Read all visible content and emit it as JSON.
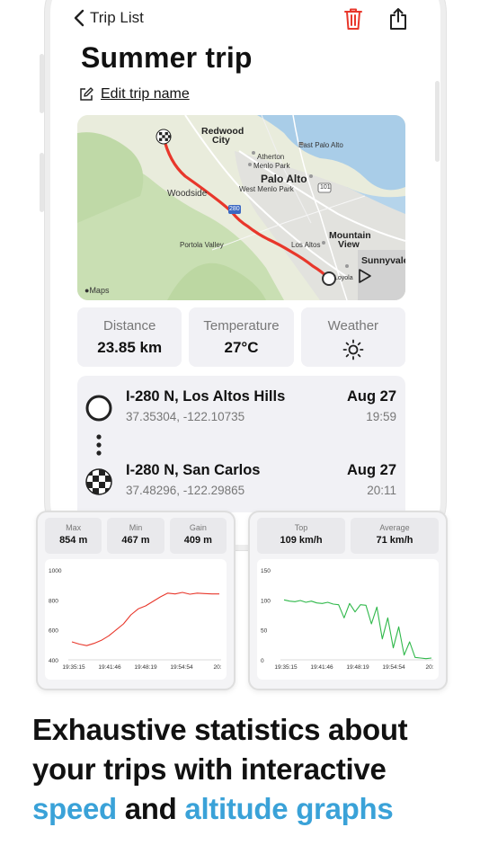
{
  "nav": {
    "back_label": "Trip List"
  },
  "trip": {
    "title": "Summer trip",
    "edit_label": "Edit trip name"
  },
  "map": {
    "labels": {
      "redwood": "Redwood",
      "city": "City",
      "east_palo_alto": "East Palo Alto",
      "atherton": "Atherton",
      "menlo_park": "Menlo Park",
      "palo_alto": "Palo Alto",
      "west_menlo_park": "West Menlo Park",
      "woodside": "Woodside",
      "portola_valley": "Portola Valley",
      "los_altos": "Los Altos",
      "mountain": "Mountain",
      "view": "View",
      "sunnyvale": "Sunnyvale",
      "loyola": "Loyola",
      "hwy_101": "101",
      "hwy_280": "280",
      "maps_logo": "Maps"
    },
    "route_color": "#e8372b"
  },
  "stats": [
    {
      "label": "Distance",
      "value": "23.85 km"
    },
    {
      "label": "Temperature",
      "value": "27°C"
    },
    {
      "label": "Weather",
      "icon": "sun-icon"
    }
  ],
  "stops": [
    {
      "name": "I-280 N, Los Altos Hills",
      "coords": "37.35304, -122.10735",
      "date": "Aug 27",
      "time": "19:59"
    },
    {
      "name": "I-280 N, San Carlos",
      "coords": "37.48296, -122.29865",
      "date": "Aug 27",
      "time": "20:11"
    }
  ],
  "altitude": {
    "stats": [
      {
        "label": "Max",
        "value": "854 m"
      },
      {
        "label": "Min",
        "value": "467 m"
      },
      {
        "label": "Gain",
        "value": "409 m"
      }
    ]
  },
  "speed": {
    "stats": [
      {
        "label": "Top",
        "value": "109 km/h"
      },
      {
        "label": "Average",
        "value": "71 km/h"
      }
    ]
  },
  "headline": {
    "line1": "Exhaustive statistics about",
    "line2": "your trips with interactive",
    "word_speed": "speed",
    "word_and": " and ",
    "word_altitude": "altitude graphs"
  },
  "colors": {
    "accent": "#3aa2d8",
    "trash": "#e8372b",
    "altitude_line": "#e8372b",
    "speed_line": "#2fb84a"
  },
  "chart_data": [
    {
      "type": "line",
      "series": [
        {
          "values": [
            520,
            505,
            495,
            510,
            530,
            560,
            600,
            640,
            700,
            740,
            760,
            790,
            820,
            845,
            840,
            850,
            838,
            845,
            842,
            840,
            840
          ]
        }
      ],
      "x_ticks": [
        "19:35:15",
        "19:41:46",
        "19:48:19",
        "19:54:54",
        "20:"
      ],
      "y_ticks": [
        "400",
        "600",
        "800",
        "1000"
      ],
      "ylim": [
        400,
        1000
      ],
      "color": "#e8372b"
    },
    {
      "type": "line",
      "series": [
        {
          "values": [
            100,
            98,
            97,
            99,
            96,
            98,
            95,
            94,
            96,
            93,
            92,
            70,
            94,
            80,
            92,
            91,
            60,
            88,
            35,
            70,
            20,
            55,
            8,
            30,
            4,
            3,
            2,
            3
          ]
        }
      ],
      "x_ticks": [
        "19:35:15",
        "19:41:46",
        "19:48:19",
        "19:54:54",
        "20:"
      ],
      "y_ticks": [
        "0",
        "50",
        "100",
        "150"
      ],
      "ylim": [
        0,
        150
      ],
      "color": "#2fb84a"
    }
  ]
}
